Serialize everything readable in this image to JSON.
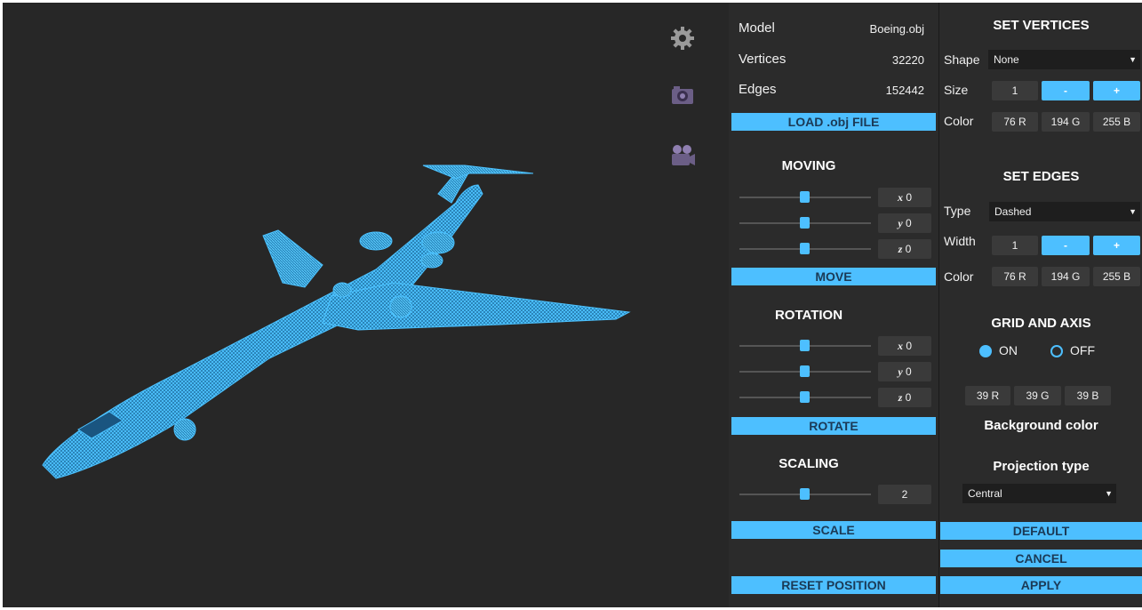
{
  "model_info": {
    "model_label": "Model",
    "model_value": "Boeing.obj",
    "vertices_label": "Vertices",
    "vertices_value": "32220",
    "edges_label": "Edges",
    "edges_value": "152442",
    "load_button": "LOAD .obj FILE"
  },
  "tools": [
    "gear-icon",
    "camera-icon",
    "video-camera-icon"
  ],
  "moving": {
    "title": "MOVING",
    "axes": [
      {
        "axis": "x",
        "value": "0",
        "level": 0.5
      },
      {
        "axis": "y",
        "value": "0",
        "level": 0.5
      },
      {
        "axis": "z",
        "value": "0",
        "level": 0.5
      }
    ],
    "button": "MOVE"
  },
  "rotation": {
    "title": "ROTATION",
    "axes": [
      {
        "axis": "x",
        "value": "0",
        "level": 0.5
      },
      {
        "axis": "y",
        "value": "0",
        "level": 0.5
      },
      {
        "axis": "z",
        "value": "0",
        "level": 0.5
      }
    ],
    "button": "ROTATE"
  },
  "scaling": {
    "title": "SCALING",
    "value": "2",
    "level": 0.5,
    "button": "SCALE"
  },
  "reset_button": "RESET POSITION",
  "set_vertices": {
    "title": "SET VERTICES",
    "shape_label": "Shape",
    "shape_value": "None",
    "size_label": "Size",
    "size_value": "1",
    "minus": "-",
    "plus": "+",
    "color_label": "Color",
    "r": "76 R",
    "g": "194 G",
    "b": "255 B"
  },
  "set_edges": {
    "title": "SET EDGES",
    "type_label": "Type",
    "type_value": "Dashed",
    "width_label": "Width",
    "width_value": "1",
    "minus": "-",
    "plus": "+",
    "color_label": "Color",
    "r": "76 R",
    "g": "194 G",
    "b": "255 B"
  },
  "grid": {
    "title": "GRID AND AXIS",
    "on": "ON",
    "off": "OFF",
    "selected": "ON",
    "r": "39 R",
    "g": "39 G",
    "b": "39 B",
    "bg_label": "Background color"
  },
  "projection": {
    "title": "Projection type",
    "value": "Central"
  },
  "buttons": {
    "default": "DEFAULT",
    "cancel": "CANCEL",
    "apply": "APPLY"
  },
  "colors": {
    "accent": "#4dbfff",
    "model": "#4cc2ff",
    "viewport_bg": "#272727",
    "panel_bg": "#2b2b2b"
  }
}
